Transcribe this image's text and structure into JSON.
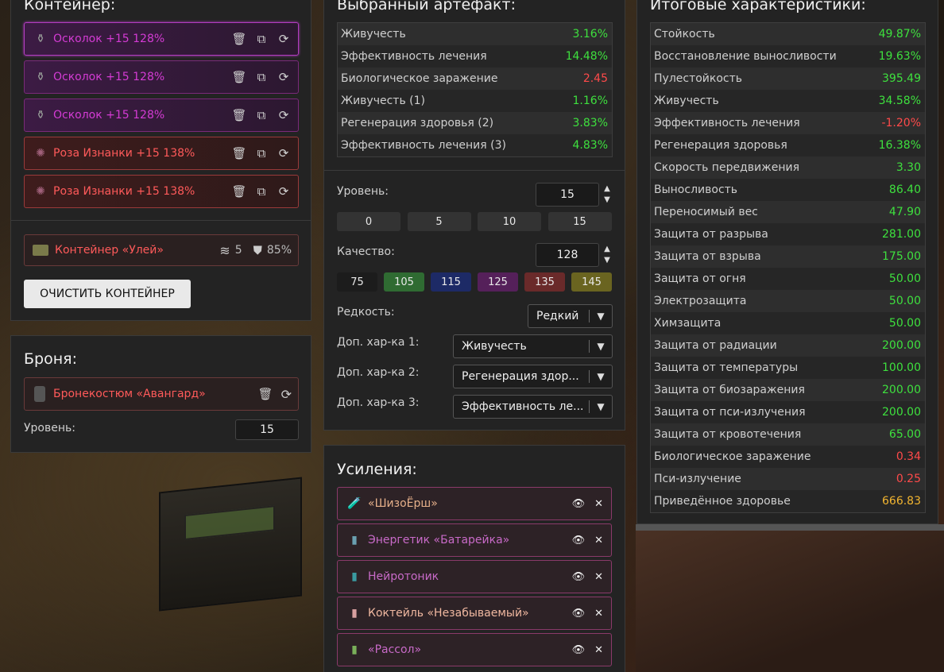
{
  "container": {
    "title": "Контейнер:",
    "artifacts": [
      {
        "name": "Осколок +15 128%",
        "color": "purple",
        "selected": true
      },
      {
        "name": "Осколок +15 128%",
        "color": "purple",
        "selected": false
      },
      {
        "name": "Осколок +15 128%",
        "color": "purple",
        "selected": false
      },
      {
        "name": "Роза Изнанки +15 138%",
        "color": "red",
        "selected": false
      },
      {
        "name": "Роза Изнанки +15 138%",
        "color": "red",
        "selected": false
      }
    ],
    "box": {
      "name": "Контейнер «Улей»",
      "slots": "5",
      "protection": "85%"
    },
    "clear_label": "ОЧИСТИТЬ КОНТЕЙНЕР"
  },
  "armor": {
    "title": "Броня:",
    "name": "Бронекостюм «Авангард»",
    "level_label": "Уровень:",
    "level_value": "15"
  },
  "selected_artifact": {
    "title": "Выбранный артефакт:",
    "stats": [
      {
        "name": "Живучесть",
        "value": "3.16%",
        "tone": "pos"
      },
      {
        "name": "Эффективность лечения",
        "value": "14.48%",
        "tone": "pos"
      },
      {
        "name": "Биологическое заражение",
        "value": "2.45",
        "tone": "neg"
      },
      {
        "name": "Живучесть (1)",
        "value": "1.16%",
        "tone": "pos"
      },
      {
        "name": "Регенерация здоровья (2)",
        "value": "3.83%",
        "tone": "pos"
      },
      {
        "name": "Эффективность лечения (3)",
        "value": "4.83%",
        "tone": "pos"
      }
    ],
    "level_label": "Уровень:",
    "level_value": "15",
    "level_presets": [
      "0",
      "5",
      "10",
      "15"
    ],
    "quality_label": "Качество:",
    "quality_value": "128",
    "quality_presets": [
      {
        "label": "75",
        "color": "#1c1c1c"
      },
      {
        "label": "105",
        "color": "#2f6b32"
      },
      {
        "label": "115",
        "color": "#1d2a66"
      },
      {
        "label": "125",
        "color": "#55205a"
      },
      {
        "label": "135",
        "color": "#6a2a2a"
      },
      {
        "label": "145",
        "color": "#6a6420"
      }
    ],
    "rarity_label": "Редкость:",
    "rarity_value": "Редкий",
    "extra1_label": "Доп. хар-ка 1:",
    "extra1_value": "Живучесть",
    "extra2_label": "Доп. хар-ка 2:",
    "extra2_value": "Регенерация здор...",
    "extra3_label": "Доп. хар-ка 3:",
    "extra3_value": "Эффективность ле..."
  },
  "boosts": {
    "title": "Усиления:",
    "items": [
      {
        "name": "«ШизоЁрш»",
        "color": "#e6b08a",
        "icon": "flask-icon"
      },
      {
        "name": "Энергетик «Батарейка»",
        "color": "#c86ac8",
        "icon": "can-icon"
      },
      {
        "name": "Нейротоник",
        "color": "#c86ac8",
        "icon": "bottle-icon"
      },
      {
        "name": "Коктейль «Незабываемый»",
        "color": "#f0b8a0",
        "icon": "bottle-icon"
      },
      {
        "name": "«Рассол»",
        "color": "#c86ac8",
        "icon": "jar-icon"
      }
    ]
  },
  "totals": {
    "title": "Итоговые характеристики:",
    "stats": [
      {
        "name": "Стойкость",
        "value": "49.87%",
        "tone": "pos"
      },
      {
        "name": "Восстановление выносливости",
        "value": "19.63%",
        "tone": "pos"
      },
      {
        "name": "Пулестойкость",
        "value": "395.49",
        "tone": "pos"
      },
      {
        "name": "Живучесть",
        "value": "34.58%",
        "tone": "pos"
      },
      {
        "name": "Эффективность лечения",
        "value": "-1.20%",
        "tone": "neg"
      },
      {
        "name": "Регенерация здоровья",
        "value": "16.38%",
        "tone": "pos"
      },
      {
        "name": "Скорость передвижения",
        "value": "3.30",
        "tone": "pos"
      },
      {
        "name": "Выносливость",
        "value": "86.40",
        "tone": "pos"
      },
      {
        "name": "Переносимый вес",
        "value": "47.90",
        "tone": "pos"
      },
      {
        "name": "Защита от разрыва",
        "value": "281.00",
        "tone": "pos"
      },
      {
        "name": "Защита от взрыва",
        "value": "175.00",
        "tone": "pos"
      },
      {
        "name": "Защита от огня",
        "value": "50.00",
        "tone": "pos"
      },
      {
        "name": "Электрозащита",
        "value": "50.00",
        "tone": "pos"
      },
      {
        "name": "Химзащита",
        "value": "50.00",
        "tone": "pos"
      },
      {
        "name": "Защита от радиации",
        "value": "200.00",
        "tone": "pos"
      },
      {
        "name": "Защита от температуры",
        "value": "100.00",
        "tone": "pos"
      },
      {
        "name": "Защита от биозаражения",
        "value": "200.00",
        "tone": "pos"
      },
      {
        "name": "Защита от пси-излучения",
        "value": "200.00",
        "tone": "pos"
      },
      {
        "name": "Защита от кровотечения",
        "value": "65.00",
        "tone": "pos"
      },
      {
        "name": "Биологическое заражение",
        "value": "0.34",
        "tone": "neg"
      },
      {
        "name": "Пси-излучение",
        "value": "0.25",
        "tone": "neg"
      },
      {
        "name": "Приведённое здоровье",
        "value": "666.83",
        "tone": "gold"
      }
    ]
  }
}
